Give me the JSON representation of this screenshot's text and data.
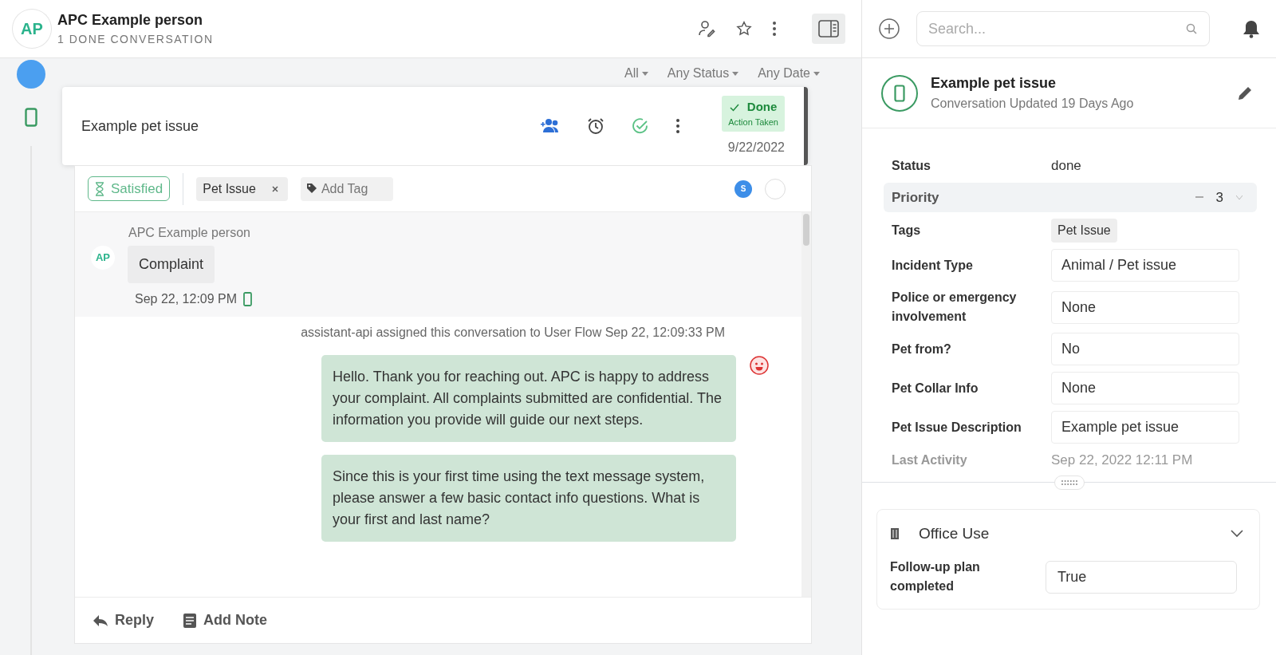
{
  "header": {
    "avatar": "AP",
    "name": "APC Example person",
    "subtitle": "1 DONE CONVERSATION"
  },
  "search": {
    "placeholder": "Search..."
  },
  "filters": [
    {
      "label": "All"
    },
    {
      "label": "Any Status"
    },
    {
      "label": "Any Date"
    }
  ],
  "conversation": {
    "title": "Example pet issue",
    "status": "Done",
    "status_note": "Action Taken",
    "date": "9/22/2022",
    "selected": true
  },
  "tag_bar": {
    "satisfaction": "Satisfied",
    "tags": [
      "Pet Issue"
    ],
    "add_tag_placeholder": "Add Tag",
    "agent_initial": "S"
  },
  "messages": [
    {
      "kind": "inbound",
      "author": "APC Example person",
      "avatar": "AP",
      "text": "Complaint",
      "time": "Sep 22, 12:09 PM"
    },
    {
      "kind": "event",
      "text": "assistant-api assigned this conversation to User Flow Sep 22, 12:09:33 PM"
    },
    {
      "kind": "outbound",
      "bot_avatar": true,
      "text": "Hello. Thank you for reaching out. APC is happy to address your complaint. All complaints submitted are confidential. The information you provide will guide our next steps."
    },
    {
      "kind": "outbound",
      "bot_avatar": false,
      "text": "Since this is your first time using the text message system, please answer a few basic contact info questions. What is your first and last name?"
    }
  ],
  "composer_tabs": [
    {
      "kind": "reply",
      "label": "Reply"
    },
    {
      "kind": "note",
      "label": "Add Note"
    }
  ],
  "details": {
    "title": "Example pet issue",
    "subtitle": "Conversation Updated 19 Days Ago",
    "fields": [
      {
        "kind": "text",
        "label": "Status",
        "value": "done"
      },
      {
        "kind": "priority",
        "label": "Priority",
        "value": "3"
      },
      {
        "kind": "tag",
        "label": "Tags",
        "value": "Pet Issue"
      },
      {
        "kind": "input",
        "label": "Incident Type",
        "value": "Animal / Pet issue"
      },
      {
        "kind": "input",
        "label": "Police or emergency involvement",
        "value": "None"
      },
      {
        "kind": "input",
        "label": "Pet from?",
        "value": "No"
      },
      {
        "kind": "input",
        "label": "Pet Collar Info",
        "value": "None"
      },
      {
        "kind": "input",
        "label": "Pet Issue Description",
        "value": "Example pet issue"
      },
      {
        "kind": "muted",
        "label": "Last Activity",
        "value": "Sep 22, 2022 12:11 PM"
      }
    ]
  },
  "office_use": {
    "title": "Office Use",
    "expanded": true,
    "fields": [
      {
        "kind": "select",
        "label": "Follow-up plan completed",
        "value": "True"
      }
    ]
  }
}
